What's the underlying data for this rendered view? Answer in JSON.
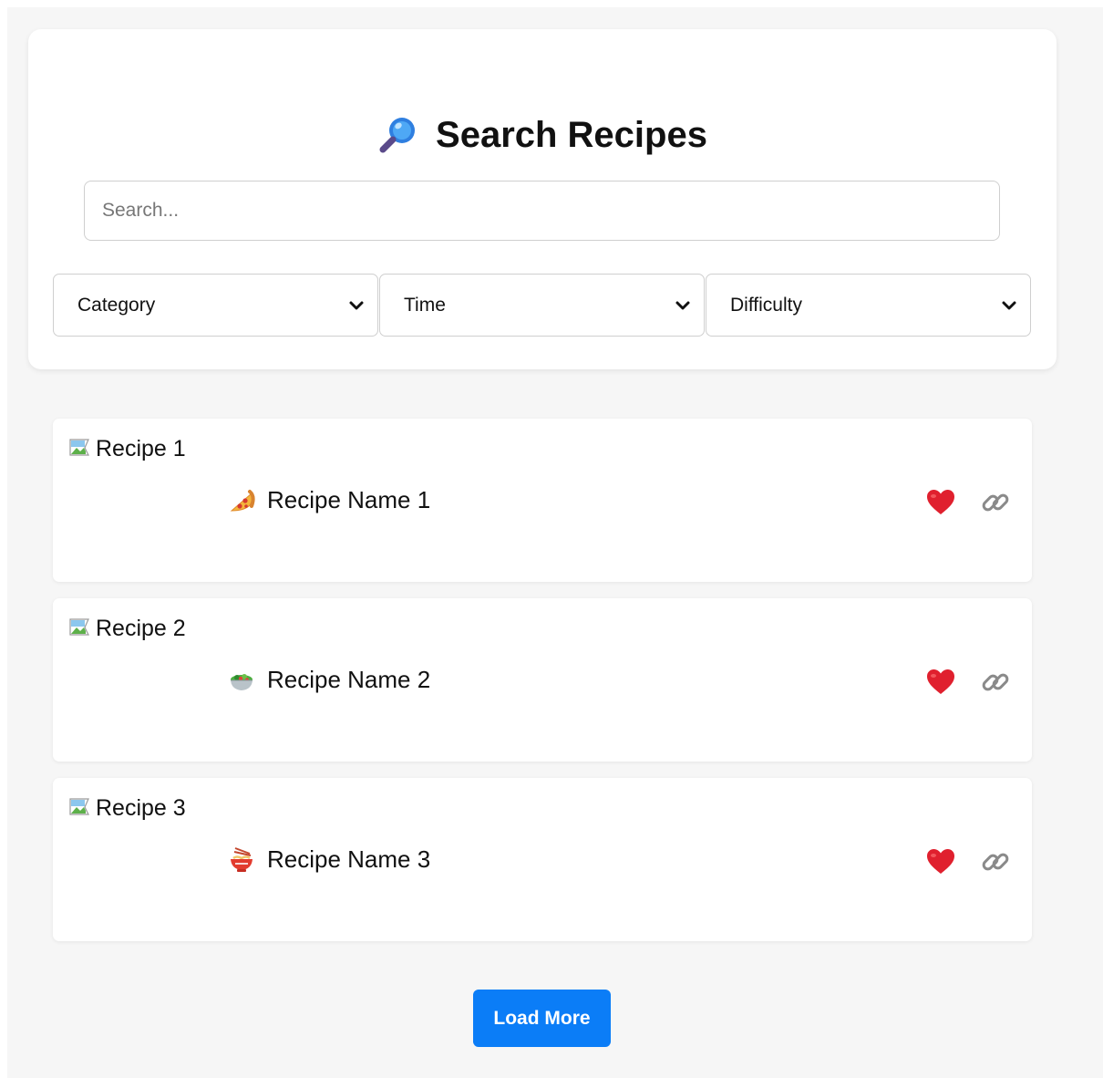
{
  "header": {
    "title": "Search Recipes",
    "title_icon": "magnifying-glass-icon"
  },
  "search": {
    "placeholder": "Search...",
    "value": ""
  },
  "filters": [
    {
      "label": "Category"
    },
    {
      "label": "Time"
    },
    {
      "label": "Difficulty"
    }
  ],
  "recipes": [
    {
      "image_alt": "Recipe 1",
      "name": "Recipe Name 1",
      "icon": "pizza-icon"
    },
    {
      "image_alt": "Recipe 2",
      "name": "Recipe Name 2",
      "icon": "salad-bowl-icon"
    },
    {
      "image_alt": "Recipe 3",
      "name": "Recipe Name 3",
      "icon": "noodle-bowl-icon"
    }
  ],
  "load_more_label": "Load More",
  "colors": {
    "accent": "#0b7df7",
    "heart": "#e0202e",
    "background": "#f6f6f6"
  }
}
